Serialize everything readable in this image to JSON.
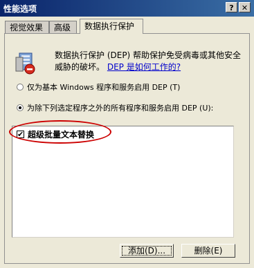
{
  "window": {
    "title": "性能选项",
    "help_glyph": "?",
    "close_glyph": "✕"
  },
  "tabs": [
    {
      "label": "视觉效果"
    },
    {
      "label": "高级"
    },
    {
      "label": "数据执行保护"
    }
  ],
  "dep": {
    "description": "数据执行保护 (DEP) 帮助保护免受病毒或其他安全威胁的破坏。",
    "link": "DEP 是如何工作的?"
  },
  "options": {
    "radio1_label": "仅为基本 Windows 程序和服务启用 DEP (T)",
    "radio2_label": "为除下列选定程序之外的所有程序和服务启用 DEP (U):"
  },
  "exceptions": {
    "items": [
      {
        "label": "超级批量文本替换",
        "checked": true
      }
    ]
  },
  "buttons": {
    "add_label": "添加(D)...",
    "remove_label": "删除(E)"
  },
  "colors": {
    "annotation": "#cc0000",
    "titlebar_start": "#0a246a",
    "link": "#0000cc"
  }
}
